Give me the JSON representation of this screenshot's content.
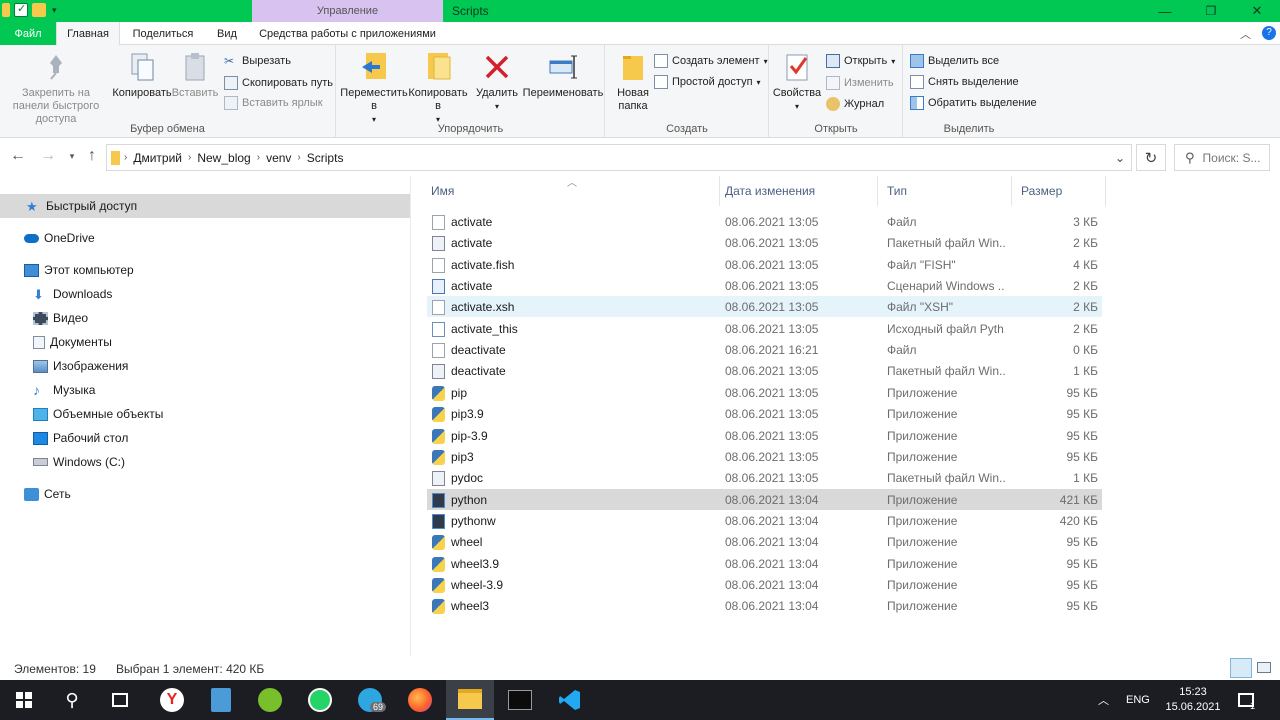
{
  "window": {
    "title": "Scripts",
    "context_tab": "Управление",
    "minimize": "—",
    "restore": "❐",
    "close": "✕"
  },
  "ribbon_tabs": {
    "file": "Файл",
    "home": "Главная",
    "share": "Поделиться",
    "view": "Вид",
    "app_tools": "Средства работы с приложениями"
  },
  "ribbon": {
    "clipboard": {
      "label": "Буфер обмена",
      "pin": "Закрепить на панели быстрого доступа",
      "copy": "Копировать",
      "paste": "Вставить",
      "cut": "Вырезать",
      "copy_path": "Скопировать путь",
      "paste_shortcut": "Вставить ярлык"
    },
    "organize": {
      "label": "Упорядочить",
      "move_to": "Переместить в",
      "copy_to": "Копировать в",
      "delete": "Удалить",
      "rename": "Переименовать"
    },
    "create": {
      "label": "Создать",
      "new_folder": "Новая папка",
      "new_item": "Создать элемент",
      "easy_access": "Простой доступ"
    },
    "open": {
      "label": "Открыть",
      "properties": "Свойства",
      "open": "Открыть",
      "edit": "Изменить",
      "history": "Журнал"
    },
    "select": {
      "label": "Выделить",
      "select_all": "Выделить все",
      "select_none": "Снять выделение",
      "invert": "Обратить выделение"
    }
  },
  "address": {
    "crumbs": [
      "Дмитрий",
      "New_blog",
      "venv",
      "Scripts"
    ],
    "search_placeholder": "Поиск: S..."
  },
  "sidebar": {
    "quick_access": "Быстрый доступ",
    "onedrive": "OneDrive",
    "this_pc": "Этот компьютер",
    "downloads": "Downloads",
    "videos": "Видео",
    "documents": "Документы",
    "pictures": "Изображения",
    "music": "Музыка",
    "objects3d": "Объемные объекты",
    "desktop": "Рабочий стол",
    "drive_c": "Windows (C:)",
    "network": "Сеть"
  },
  "columns": {
    "name": "Имя",
    "date": "Дата изменения",
    "type": "Тип",
    "size": "Размер"
  },
  "files": [
    {
      "name": "activate",
      "date": "08.06.2021 13:05",
      "type": "Файл",
      "size": "3 КБ",
      "icon": "blank-file-icon"
    },
    {
      "name": "activate",
      "date": "08.06.2021 13:05",
      "type": "Пакетный файл Win...",
      "size": "2 КБ",
      "icon": "batch-file-icon"
    },
    {
      "name": "activate.fish",
      "date": "08.06.2021 13:05",
      "type": "Файл \"FISH\"",
      "size": "4 КБ",
      "icon": "blank-file-icon"
    },
    {
      "name": "activate",
      "date": "08.06.2021 13:05",
      "type": "Сценарий Windows ...",
      "size": "2 КБ",
      "icon": "powershell-file-icon"
    },
    {
      "name": "activate.xsh",
      "date": "08.06.2021 13:05",
      "type": "Файл \"XSH\"",
      "size": "2 КБ",
      "icon": "blank-file-icon"
    },
    {
      "name": "activate_this",
      "date": "08.06.2021 13:05",
      "type": "Исходный файл Pyth...",
      "size": "2 КБ",
      "icon": "python-source-icon"
    },
    {
      "name": "deactivate",
      "date": "08.06.2021 16:21",
      "type": "Файл",
      "size": "0 КБ",
      "icon": "blank-file-icon"
    },
    {
      "name": "deactivate",
      "date": "08.06.2021 13:05",
      "type": "Пакетный файл Win...",
      "size": "1 КБ",
      "icon": "batch-file-icon"
    },
    {
      "name": "pip",
      "date": "08.06.2021 13:05",
      "type": "Приложение",
      "size": "95 КБ",
      "icon": "python-exe-icon"
    },
    {
      "name": "pip3.9",
      "date": "08.06.2021 13:05",
      "type": "Приложение",
      "size": "95 КБ",
      "icon": "python-exe-icon"
    },
    {
      "name": "pip-3.9",
      "date": "08.06.2021 13:05",
      "type": "Приложение",
      "size": "95 КБ",
      "icon": "python-exe-icon"
    },
    {
      "name": "pip3",
      "date": "08.06.2021 13:05",
      "type": "Приложение",
      "size": "95 КБ",
      "icon": "python-exe-icon"
    },
    {
      "name": "pydoc",
      "date": "08.06.2021 13:05",
      "type": "Пакетный файл Win...",
      "size": "1 КБ",
      "icon": "batch-file-icon"
    },
    {
      "name": "python",
      "date": "08.06.2021 13:04",
      "type": "Приложение",
      "size": "421 КБ",
      "icon": "python-app-icon"
    },
    {
      "name": "pythonw",
      "date": "08.06.2021 13:04",
      "type": "Приложение",
      "size": "420 КБ",
      "icon": "python-app-icon"
    },
    {
      "name": "wheel",
      "date": "08.06.2021 13:04",
      "type": "Приложение",
      "size": "95 КБ",
      "icon": "python-exe-icon"
    },
    {
      "name": "wheel3.9",
      "date": "08.06.2021 13:04",
      "type": "Приложение",
      "size": "95 КБ",
      "icon": "python-exe-icon"
    },
    {
      "name": "wheel-3.9",
      "date": "08.06.2021 13:04",
      "type": "Приложение",
      "size": "95 КБ",
      "icon": "python-exe-icon"
    },
    {
      "name": "wheel3",
      "date": "08.06.2021 13:04",
      "type": "Приложение",
      "size": "95 КБ",
      "icon": "python-exe-icon"
    }
  ],
  "status": {
    "items": "Элементов: 19",
    "selected": "Выбран 1 элемент: 420 КБ"
  },
  "taskbar": {
    "telegram_badge": "69",
    "lang": "ENG",
    "time": "15:23",
    "date": "15.06.2021",
    "notif_count": "1"
  },
  "colors": {
    "accent": "#00c853",
    "context_tab": "#d8c3f0",
    "selected_row": "#d9d9d9",
    "hover_row": "#e5f3fb",
    "taskbar": "#1b1d22"
  }
}
